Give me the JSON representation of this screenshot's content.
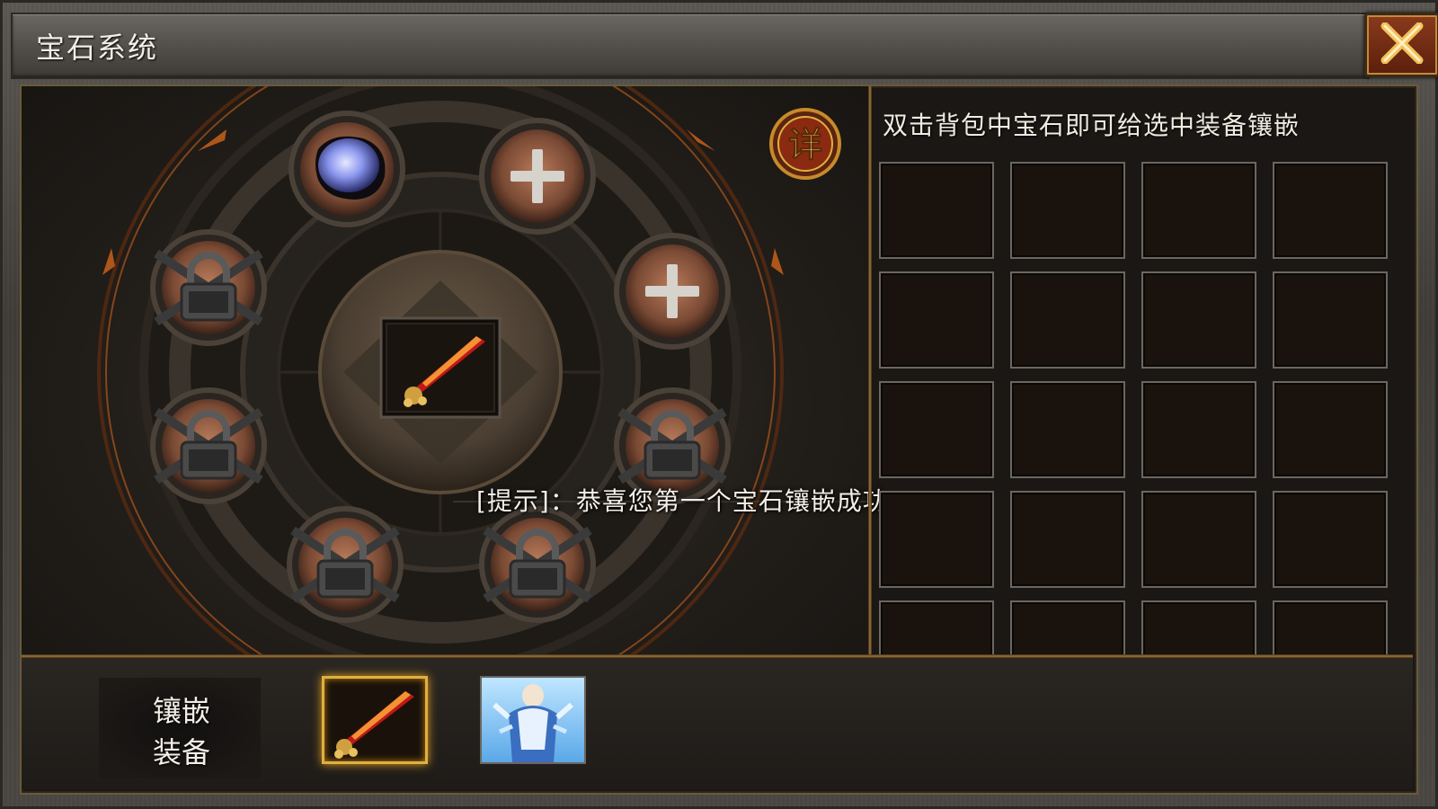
{
  "window": {
    "title": "宝石系统",
    "close_icon": "close-x-icon"
  },
  "detail_button": {
    "label": "详"
  },
  "inventory": {
    "hint": "双击背包中宝石即可给选中装备镶嵌",
    "rows_visible": 5,
    "columns": 4
  },
  "socket_disc": {
    "center_item": "sword-icon",
    "sockets": [
      {
        "state": "filled",
        "icon": "blue-gem-icon"
      },
      {
        "state": "empty",
        "icon": "plus-icon"
      },
      {
        "state": "empty",
        "icon": "plus-icon"
      },
      {
        "state": "locked",
        "icon": "lock-icon"
      },
      {
        "state": "locked",
        "icon": "lock-icon"
      },
      {
        "state": "locked",
        "icon": "lock-icon"
      },
      {
        "state": "locked",
        "icon": "lock-icon"
      },
      {
        "state": "locked",
        "icon": "lock-icon"
      }
    ]
  },
  "tip_message": "[提示]：恭喜您第一个宝石镶嵌成功",
  "bottom_tab": {
    "line1": "镶嵌",
    "line2": "装备"
  },
  "equipment": [
    {
      "name": "sword",
      "icon": "sword-icon",
      "selected": true
    },
    {
      "name": "armor",
      "icon": "armor-icon",
      "selected": false
    }
  ],
  "colors": {
    "accent_gold": "#e0b040",
    "close_red": "#8a3a1c",
    "gem_blue": "#9aa8ff"
  }
}
